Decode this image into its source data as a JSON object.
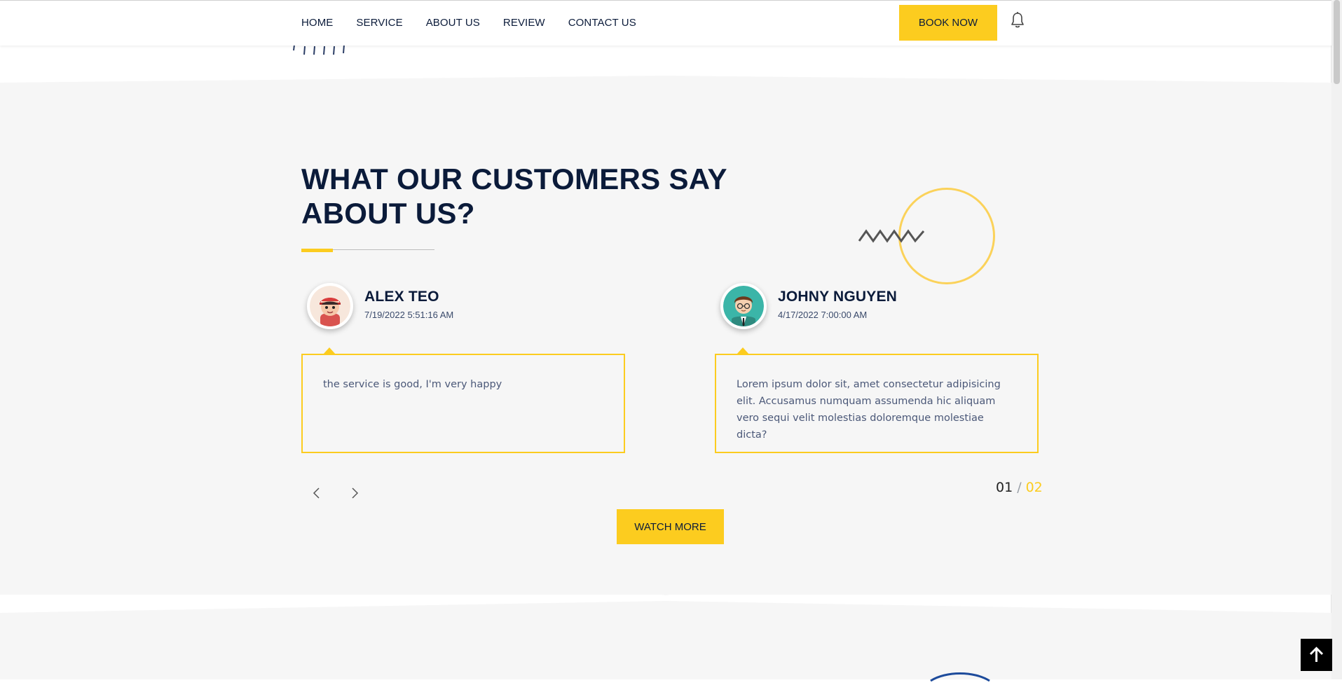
{
  "nav": {
    "items": [
      "HOME",
      "SERVICE",
      "ABOUT US",
      "REVIEW",
      "CONTACT US"
    ],
    "book_label": "BOOK NOW",
    "bell_icon": "bell-icon"
  },
  "testimonials": {
    "title": "WHAT OUR CUSTOMERS SAY ABOUT US?",
    "accent_color": "#fccc1f",
    "heading_color": "#0b1b3a",
    "items": [
      {
        "name": "ALEX TEO",
        "date": "7/19/2022 5:51:16 AM",
        "text": "the service is good, I'm very happy"
      },
      {
        "name": "JOHNY NGUYEN",
        "date": "4/17/2022 7:00:00 AM",
        "text": "Lorem ipsum dolor sit, amet consectetur adipisicing elit. Accusamus numquam assumenda hic aliquam vero sequi velit molestias doloremque molestiae dicta?"
      }
    ],
    "pager": {
      "current": "01",
      "separator": "/",
      "total": "02"
    },
    "watch_more_label": "WATCH MORE"
  },
  "icons": {
    "prev": "chevron-left-icon",
    "next": "chevron-right-icon",
    "to_top": "arrow-up-icon"
  }
}
